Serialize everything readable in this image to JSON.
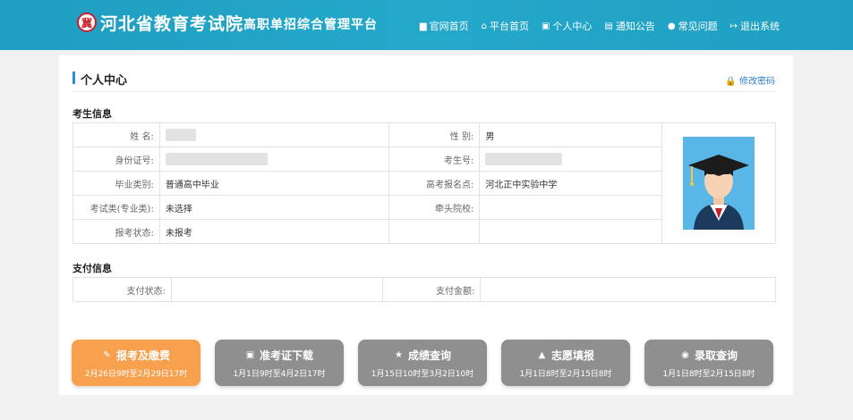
{
  "header": {
    "logo_glyph": "冀",
    "title": "河北省教育考试院",
    "subtitle": "高职单招综合管理平台",
    "nav": [
      {
        "label": "官网首页",
        "icon": "home-icon"
      },
      {
        "label": "平台首页",
        "icon": "house-icon"
      },
      {
        "label": "个人中心",
        "icon": "user-card-icon"
      },
      {
        "label": "通知公告",
        "icon": "document-icon"
      },
      {
        "label": "常见问题",
        "icon": "chat-icon"
      },
      {
        "label": "退出系统",
        "icon": "logout-icon"
      }
    ]
  },
  "page": {
    "title": "个人中心",
    "change_password": "修改密码"
  },
  "student": {
    "section_label": "考生信息",
    "name_label": "姓 名:",
    "gender_label": "性 别:",
    "gender_value": "男",
    "id_label": "身份证号:",
    "exam_no_label": "考生号:",
    "grad_type_label": "毕业类别:",
    "grad_type_value": "普通高中毕业",
    "gaokao_site_label": "高考报名点:",
    "gaokao_site_value": "河北正中实验中学",
    "exam_class_label": "考试类(专业类):",
    "exam_class_value": "未选择",
    "lead_school_label": "牵头院校:",
    "lead_school_value": "",
    "reg_status_label": "报考状态:",
    "reg_status_value": "未报考"
  },
  "payment": {
    "section_label": "支付信息",
    "status_label": "支付状态:",
    "status_value": "",
    "amount_label": "支付金额:",
    "amount_value": ""
  },
  "actions": [
    {
      "label": "报考及缴费",
      "dates": "2月26日9时至2月29日17时",
      "icon": "user-edit-icon",
      "primary": true
    },
    {
      "label": "准考证下载",
      "dates": "1月1日9时至4月2日17时",
      "icon": "id-card-icon",
      "primary": false
    },
    {
      "label": "成绩查询",
      "dates": "1月15日10时至3月2日10时",
      "icon": "star-icon",
      "primary": false
    },
    {
      "label": "志愿填报",
      "dates": "1月1日8时至2月15日8时",
      "icon": "graduation-cap-icon",
      "primary": false
    },
    {
      "label": "录取查询",
      "dates": "1月1日8时至2月15日8时",
      "icon": "search-doc-icon",
      "primary": false
    }
  ],
  "colors": {
    "header": "#1fa0c4",
    "primary_button": "#f7a04e",
    "disabled_button": "#8f8f8f"
  }
}
